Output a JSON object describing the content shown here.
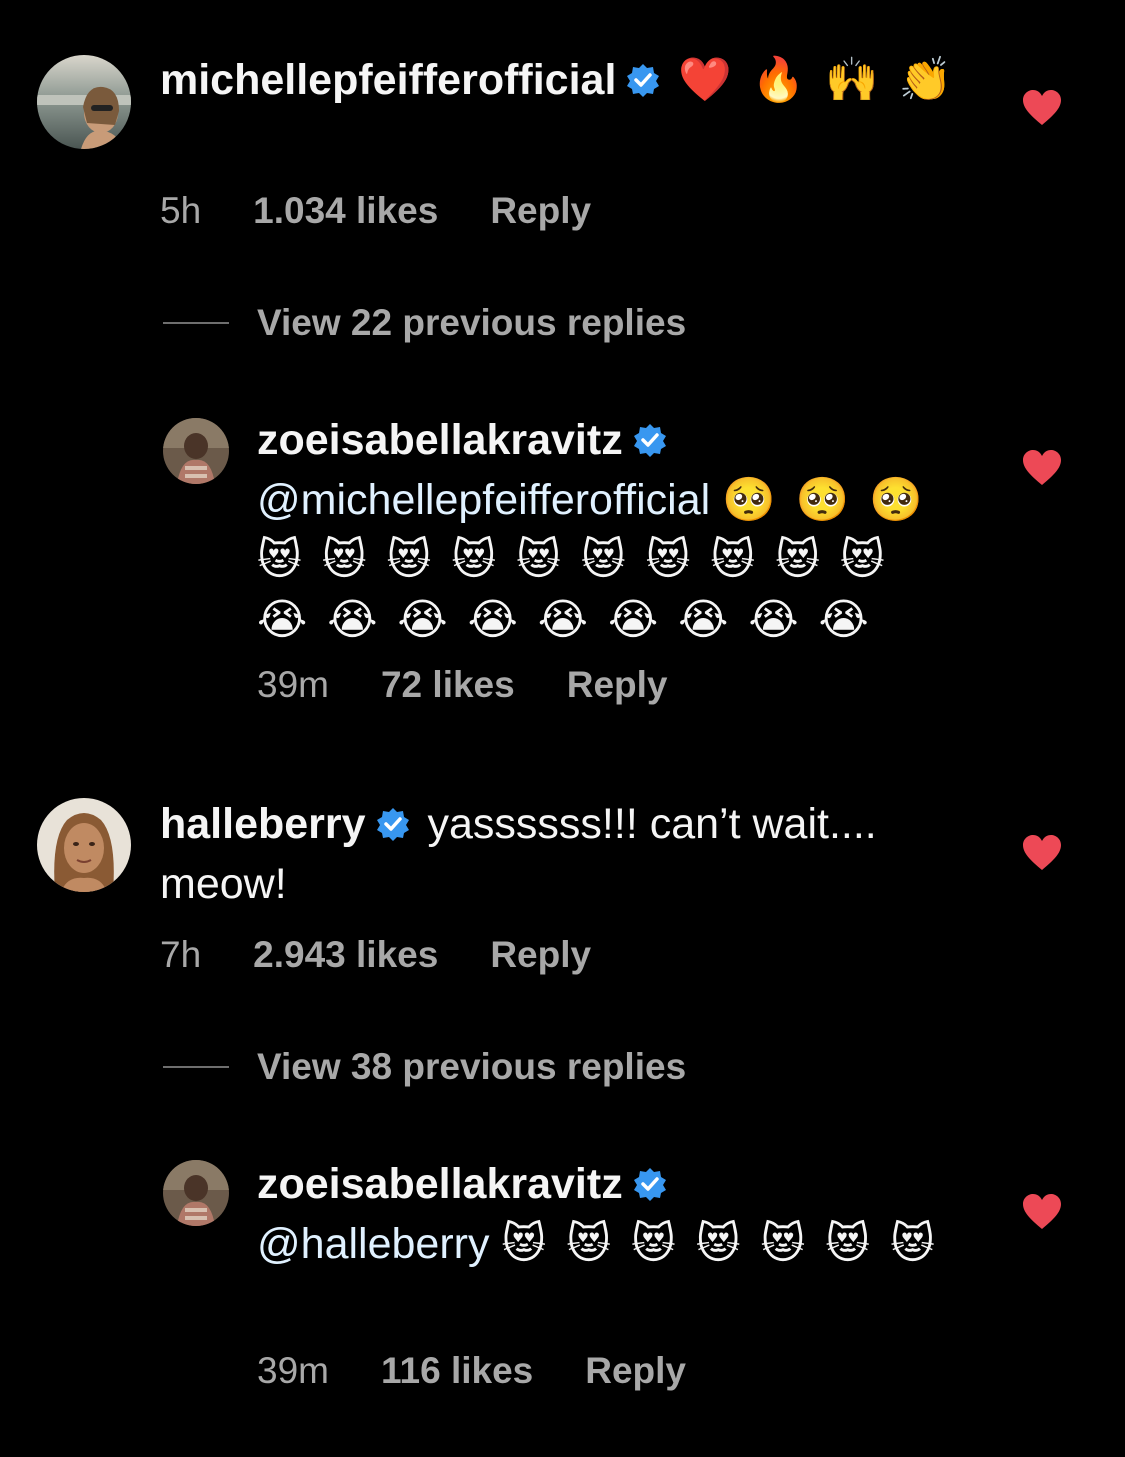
{
  "comments": [
    {
      "username": "michellepfeifferofficial",
      "text": "❤️ 🔥 🙌 👏",
      "time": "5h",
      "likes": "1.034 likes",
      "reply": "Reply"
    },
    {
      "username": "halleberry",
      "text": "yassssss!!! can’t wait.... meow!",
      "time": "7h",
      "likes": "2.943 likes",
      "reply": "Reply"
    }
  ],
  "replies": [
    {
      "view_label": "View 22 previous replies",
      "username": "zoeisabellakravitz",
      "mention": "@michellepfeifferofficial",
      "emojis": "🥺 🥺 🥺 😻 😻 😻 😻 😻 😻 😻 😻 😻 😻 😭 😭 😭 😭 😭 😭 😭 😭 😭",
      "time": "39m",
      "likes": "72 likes",
      "reply": "Reply"
    },
    {
      "view_label": "View 38 previous replies",
      "username": "zoeisabellakravitz",
      "mention": "@halleberry",
      "emojis": "😻 😻 😻 😻 😻 😻 😻",
      "time": "39m",
      "likes": "116 likes",
      "reply": "Reply"
    }
  ],
  "colors": {
    "background": "#000000",
    "heart": "#ed4956",
    "verified": "#3897f0",
    "secondary_text": "#a8a8a8"
  },
  "icons": {
    "verified": "verified-badge-icon",
    "like": "heart-icon"
  }
}
